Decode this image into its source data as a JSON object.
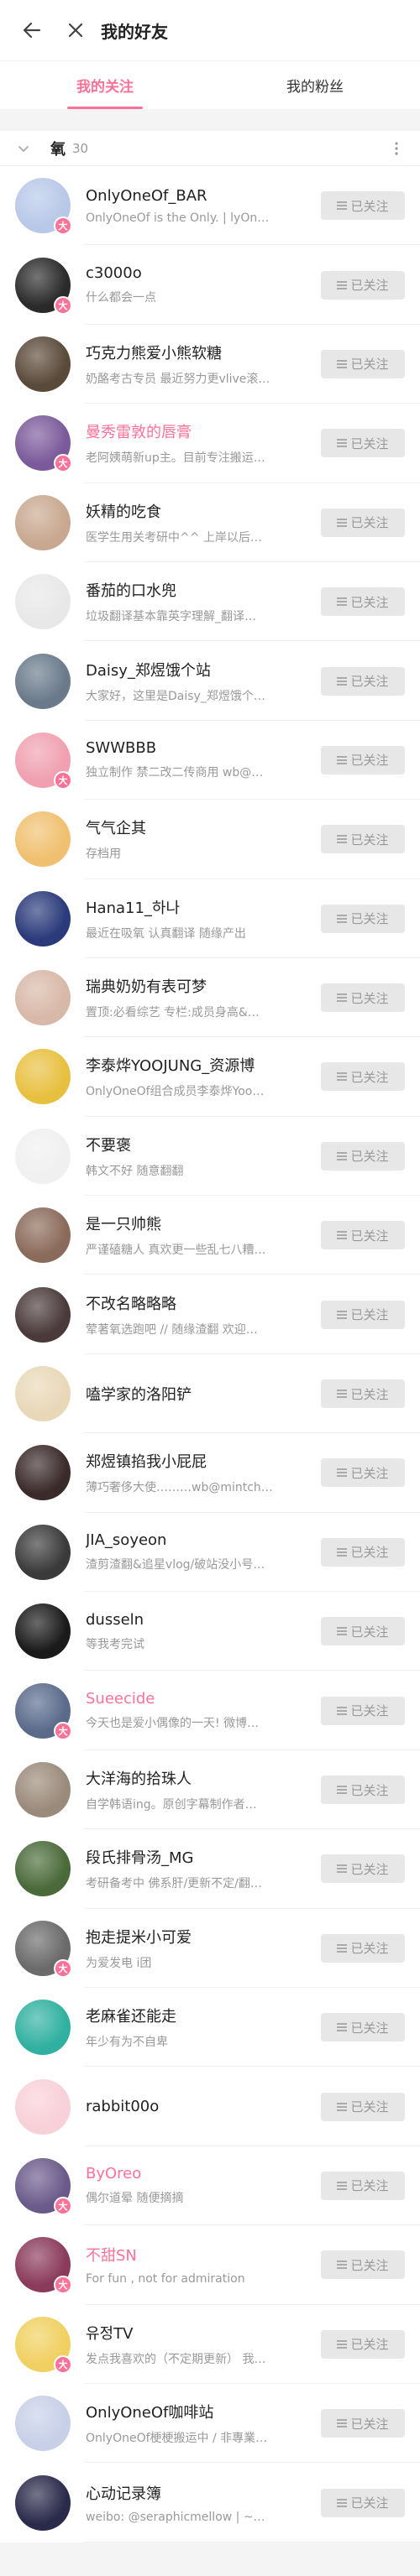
{
  "header": {
    "title": "我的好友"
  },
  "tabs": [
    {
      "label": "我的关注",
      "active": true
    },
    {
      "label": "我的粉丝",
      "active": false
    }
  ],
  "group": {
    "name": "氧",
    "count": "30"
  },
  "follow_label": "已关注",
  "accent_color": "#fb7299",
  "users": [
    {
      "name": "OnlyOneOf_BAR",
      "sign": "OnlyOneOf is the Only. | lyOn…",
      "vip": true,
      "color": "#b8c8e8"
    },
    {
      "name": "c3000o",
      "sign": "什么都会一点",
      "vip": true,
      "color": "#2a2a2a"
    },
    {
      "name": "巧克力熊爱小熊软糖",
      "sign": "奶酪考古专员 最近努力更vlive滚…",
      "vip": false,
      "color": "#5a4a3a"
    },
    {
      "name": "曼秀雷敦的唇膏",
      "sign": "老阿姨萌新up主。目前专注搬运…",
      "vip": true,
      "vipname": true,
      "color": "#7a5a9a"
    },
    {
      "name": "妖精的吃食",
      "sign": "医学生用关考研中^^ 上岸以后…",
      "vip": false,
      "color": "#c8a890"
    },
    {
      "name": "番茄的口水兜",
      "sign": "垃圾翻译基本靠英字理解_翻译…",
      "vip": false,
      "color": "#e8e8e8"
    },
    {
      "name": "Daisy_郑煜饿个站",
      "sign": "大家好，这里是Daisy_郑煜饿个…",
      "vip": false,
      "color": "#6a7a8a"
    },
    {
      "name": "SWWBBB",
      "sign": "独立制作 禁二改二传商用 wb@…",
      "vip": true,
      "color": "#f0a0b0"
    },
    {
      "name": "气气企其",
      "sign": "存档用",
      "vip": false,
      "color": "#f0c070"
    },
    {
      "name": "Hana11_하나",
      "sign": "最近在吸氧 认真翻译 随缘产出",
      "vip": false,
      "color": "#2a3a7a"
    },
    {
      "name": "瑞典奶奶有表可梦",
      "sign": "置顶:必看综艺 专栏:成员身高&…",
      "vip": false,
      "color": "#d8b8a8"
    },
    {
      "name": "李泰烨YOOJUNG_资源博",
      "sign": "OnlyOneOf组合成员李泰烨Yoo…",
      "vip": false,
      "color": "#e8c040"
    },
    {
      "name": "不要褒",
      "sign": "韩文不好 随意翻翻",
      "vip": false,
      "color": "#f0f0f0"
    },
    {
      "name": "是一只帅熊",
      "sign": "严谨磕糖人 真欢更一些乱七八糟…",
      "vip": false,
      "color": "#8a6a5a"
    },
    {
      "name": "不改名略略略",
      "sign": "荤著氧选跑吧 // 随缘渣翻 欢迎…",
      "vip": false,
      "color": "#4a3a3a"
    },
    {
      "name": "嗑学家的洛阳铲",
      "sign": "",
      "vip": false,
      "color": "#e8d8b8"
    },
    {
      "name": "郑煜镇掐我小屁屁",
      "sign": "薄巧奢侈大使………wb@mintch…",
      "vip": false,
      "color": "#3a2a2a"
    },
    {
      "name": "JIA_soyeon",
      "sign": "渣剪渣翻&追星vlog/破站没小号…",
      "vip": false,
      "color": "#3a3a3a"
    },
    {
      "name": "dusseln",
      "sign": "等我考完试",
      "vip": false,
      "color": "#1a1a1a"
    },
    {
      "name": "Sueecide",
      "sign": "今天也是爱小偶像的一天! 微博…",
      "vip": true,
      "vipname": true,
      "color": "#5a6a8a"
    },
    {
      "name": "大洋海的拾珠人",
      "sign": "自学韩语ing。原创字幕制作者…",
      "vip": false,
      "color": "#9a8a7a"
    },
    {
      "name": "段氏排骨汤_MG",
      "sign": "考研备考中 佛系肝/更新不定/翻…",
      "vip": false,
      "color": "#4a6a3a"
    },
    {
      "name": "抱走提米小可爱",
      "sign": "为爱发电 i团",
      "vip": true,
      "color": "#6a6a6a"
    },
    {
      "name": "老麻雀还能走",
      "sign": "年少有为不自卑",
      "vip": false,
      "color": "#30b0a0"
    },
    {
      "name": "rabbit00o",
      "sign": "",
      "vip": false,
      "color": "#f8d0d8"
    },
    {
      "name": "ByOreo",
      "sign": "偶尔道晕 随便摘摘",
      "vip": true,
      "vipname": true,
      "color": "#6a5a8a"
    },
    {
      "name": "不甜SN",
      "sign": "For fun , not for admiration",
      "vip": true,
      "vipname": true,
      "color": "#8a3a5a"
    },
    {
      "name": "유정TV",
      "sign": "发点我喜欢的（不定期更新） 我…",
      "vip": true,
      "color": "#f0d060"
    },
    {
      "name": "OnlyOneOf咖啡站",
      "sign": "OnlyOneOf梗梗搬运中 / 非專業…",
      "vip": false,
      "color": "#c8d0e8"
    },
    {
      "name": "心动记录簿",
      "sign": "weibo: @seraphicmellow | ~…",
      "vip": false,
      "color": "#2a2a4a"
    }
  ]
}
